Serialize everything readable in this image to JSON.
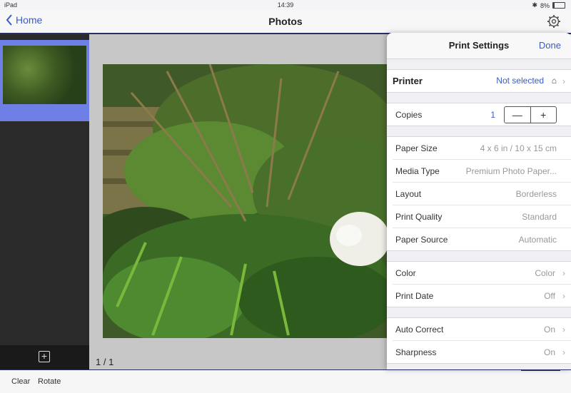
{
  "status": {
    "device": "iPad",
    "time": "14:39",
    "battery": "8%"
  },
  "nav": {
    "back_label": "Home",
    "title": "Photos"
  },
  "preview": {
    "page_indicator": "1 / 1"
  },
  "toolbar": {
    "clear_label": "Clear",
    "rotate_label": "Rotate"
  },
  "panel": {
    "title": "Print Settings",
    "done_label": "Done",
    "printer": {
      "label": "Printer",
      "value": "Not selected"
    },
    "copies": {
      "label": "Copies",
      "value": "1",
      "minus": "—",
      "plus": "+"
    },
    "paper": [
      {
        "label": "Paper Size",
        "value": "4 x 6 in / 10 x 15 cm"
      },
      {
        "label": "Media Type",
        "value": "Premium Photo Paper..."
      },
      {
        "label": "Layout",
        "value": "Borderless"
      },
      {
        "label": "Print Quality",
        "value": "Standard"
      },
      {
        "label": "Paper Source",
        "value": "Automatic"
      }
    ],
    "color_group": [
      {
        "label": "Color",
        "value": "Color"
      },
      {
        "label": "Print Date",
        "value": "Off"
      }
    ],
    "correct_group": [
      {
        "label": "Auto Correct",
        "value": "On"
      },
      {
        "label": "Sharpness",
        "value": "On"
      }
    ]
  },
  "colors": {
    "accent": "#3a5bc7",
    "selection": "#6e7fe6",
    "navy": "#2a2f6a"
  },
  "icons": [
    "back-chevron-icon",
    "gear-icon",
    "add-icon",
    "home-icon",
    "chevron-right-icon",
    "wifi-icon",
    "bluetooth-icon"
  ]
}
